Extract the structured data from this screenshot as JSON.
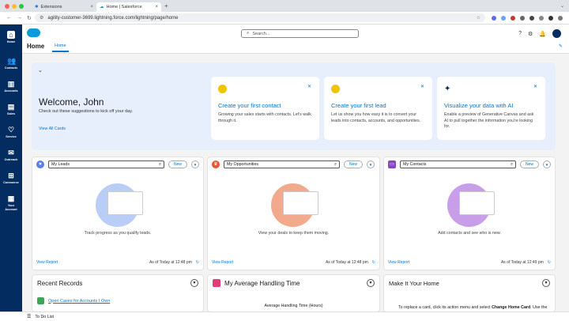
{
  "browser": {
    "tabs": [
      {
        "label": "Extensions"
      },
      {
        "label": "Home | Salesforce"
      }
    ],
    "url": "agility-customer-3699.lightning.force.com/lightning/page/home"
  },
  "nav": {
    "items": [
      {
        "label": "Home",
        "icon": "home-icon"
      },
      {
        "label": "Contacts",
        "icon": "contacts-icon"
      },
      {
        "label": "Accounts",
        "icon": "accounts-icon"
      },
      {
        "label": "Sales",
        "icon": "sales-icon"
      },
      {
        "label": "Service",
        "icon": "service-icon"
      },
      {
        "label": "Outreach",
        "icon": "outreach-icon"
      },
      {
        "label": "Commerce",
        "icon": "commerce-icon"
      },
      {
        "label": "Your Account",
        "icon": "your-account-icon"
      }
    ]
  },
  "header": {
    "search_placeholder": "Search...",
    "app_title": "Home",
    "tab_label": "Home"
  },
  "welcome": {
    "title": "Welcome, John",
    "subtitle": "Check out these suggestions to kick off your day.",
    "view_all": "View All Cards",
    "cards": [
      {
        "title": "Create your first contact",
        "desc": "Growing your sales starts with contacts. Let's walk through it."
      },
      {
        "title": "Create your first lead",
        "desc": "Let us show you how easy it is to convert your leads into contacts, accounts, and opportunities."
      },
      {
        "title": "Visualize your data with AI",
        "desc": "Enable a preview of Generative Canvas and ask AI to pull together the information you're looking for."
      }
    ]
  },
  "panels": [
    {
      "select": "My Leads",
      "new_label": "New",
      "caption": "Track progress as you qualify leads.",
      "view_report": "View Report",
      "as_of": "As of Today at 12:48 pm",
      "color": "#5a7df0"
    },
    {
      "select": "My Opportunities",
      "new_label": "New",
      "caption": "View your deals to keep them moving.",
      "view_report": "View Report",
      "as_of": "As of Today at 12:48 pm",
      "color": "#e8562e"
    },
    {
      "select": "My Contacts",
      "new_label": "New",
      "caption": "Add contacts and see who is new.",
      "view_report": "View Report",
      "as_of": "As of Today at 12:49 pm",
      "color": "#8a44c7"
    }
  ],
  "bottom_panels": {
    "recent_title": "Recent Records",
    "recent_item": "Open Cases for Accounts I Own",
    "aht_title": "My Average Handling Time",
    "aht_sub": "Average Handling Time (Hours)",
    "make_title": "Make It Your Home",
    "make_desc_a": "To replace a card, click its action menu and select ",
    "make_desc_b": "Change Home Card",
    "make_desc_c": ". Use the"
  },
  "footer": {
    "todo": "To Do List"
  }
}
